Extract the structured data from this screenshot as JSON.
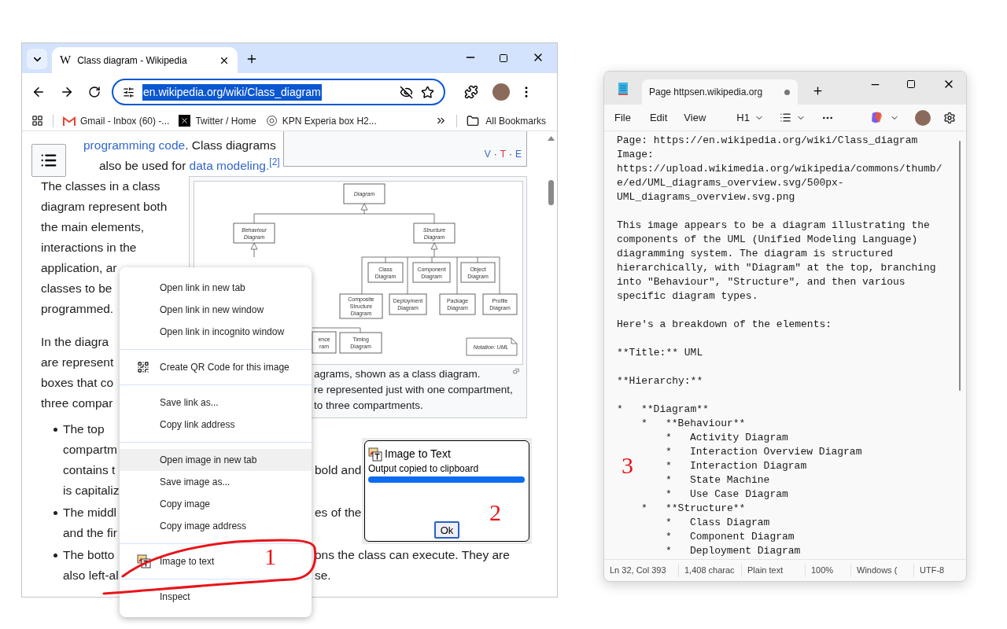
{
  "browser": {
    "tabs": [
      {
        "title": "Class diagram - Wikipedia",
        "favicon": "W",
        "selected": true
      }
    ],
    "address": {
      "url": "en.wikipedia.org/wiki/Class_diagram",
      "selected": true
    },
    "bookmarks": [
      {
        "label": "Gmail - Inbox (60) -...",
        "kind": "gmail"
      },
      {
        "label": "Twitter / Home",
        "kind": "x"
      },
      {
        "label": "KPN Experia box H2...",
        "kind": "kpn"
      }
    ],
    "all_bookmarks": "All Bookmarks",
    "navbox": {
      "links": [
        {
          "text": "V",
          "color": "#3366cc"
        },
        {
          "text": "T",
          "color": "#dd3333"
        },
        {
          "text": "E",
          "color": "#3366cc"
        }
      ],
      "separator": "·"
    },
    "intro": [
      [
        {
          "text": "programming code",
          "link": true
        },
        {
          "text": ". Class diagrams",
          "link": false
        }
      ],
      [
        {
          "text": "also be used for ",
          "link": false
        },
        {
          "text": "data modeling.",
          "link": true
        },
        {
          "text": "[2]",
          "link": true,
          "sup": true
        }
      ]
    ],
    "paragraphs": [
      [
        "The classes in a class",
        "diagram represent both",
        "the main elements,",
        "interactions in the",
        "application, ar",
        "classes to be",
        "programmed."
      ],
      [
        "In the diagra",
        "are represent",
        "boxes that co",
        "three compar"
      ]
    ],
    "figure": {
      "nodes": [
        {
          "lines": [
            "Diagram"
          ],
          "abstract": true
        },
        {
          "lines": [
            "Behaviour",
            "Diagram"
          ],
          "abstract": true
        },
        {
          "lines": [
            "Structure",
            "Diagram"
          ],
          "abstract": true
        },
        {
          "lines": [
            "Class",
            "Diagram"
          ],
          "abstract": false
        },
        {
          "lines": [
            "Component",
            "Diagram"
          ],
          "abstract": false
        },
        {
          "lines": [
            "Object",
            "Diagram"
          ],
          "abstract": false
        },
        {
          "lines": [
            "Composite",
            "Structure",
            "Diagram"
          ],
          "abstract": false
        },
        {
          "lines": [
            "Deployment",
            "Diagram"
          ],
          "abstract": false
        },
        {
          "lines": [
            "Package",
            "Diagram"
          ],
          "abstract": false
        },
        {
          "lines": [
            "Profile",
            "Diagram"
          ],
          "abstract": false
        },
        {
          "lines": [
            "ence",
            "ram"
          ],
          "abstract": false
        },
        {
          "lines": [
            "Timing",
            "Diagram"
          ],
          "abstract": false
        }
      ],
      "note": "Notation: UML",
      "caption": [
        "agrams, shown as a class diagram.",
        "re represented just with one compartment,",
        "to three compartments."
      ]
    },
    "bullets": [
      [
        {
          "left": "The top"
        },
        {
          "left": "compartm"
        },
        {
          "left": "contains t",
          "right": "bold and"
        },
        {
          "left": "is capitaliz"
        }
      ],
      [
        {
          "left": "The middl",
          "right": "es of the"
        },
        {
          "left": "and the fir"
        }
      ],
      [
        {
          "left": "The botto",
          "right": "ons the class can execute. They are"
        },
        {
          "left": "also left-al",
          "right": "se."
        }
      ]
    ]
  },
  "context_menu": {
    "groups": [
      [
        {
          "label": "Open link in new tab",
          "kind": "plain",
          "highlighted": false
        },
        {
          "label": "Open link in new window",
          "kind": "plain",
          "highlighted": false
        },
        {
          "label": "Open link in incognito window",
          "kind": "plain",
          "highlighted": false
        }
      ],
      [
        {
          "label": "Create QR Code for this image",
          "kind": "qr",
          "highlighted": false
        }
      ],
      [
        {
          "label": "Save link as...",
          "kind": "plain",
          "highlighted": false
        },
        {
          "label": "Copy link address",
          "kind": "plain",
          "highlighted": false
        }
      ],
      [
        {
          "label": "Open image in new tab",
          "kind": "plain",
          "highlighted": true
        },
        {
          "label": "Save image as...",
          "kind": "plain",
          "highlighted": false
        },
        {
          "label": "Copy image",
          "kind": "plain",
          "highlighted": false
        },
        {
          "label": "Copy image address",
          "kind": "plain",
          "highlighted": false
        }
      ],
      [
        {
          "label": "Image to text",
          "kind": "extension",
          "highlighted": false
        }
      ],
      [
        {
          "label": "Inspect",
          "kind": "plain",
          "highlighted": false
        }
      ]
    ]
  },
  "dialog": {
    "title": "Image to Text",
    "message": "Output copied to clipboard",
    "progress": {
      "level": 1
    },
    "button": "Ok"
  },
  "notepad": {
    "tab": {
      "title": "Page httpsen.wikipedia.org",
      "modified": true
    },
    "menu": [
      "File",
      "Edit",
      "View"
    ],
    "heading": "H1",
    "blocks": [
      [
        "Page: https://en.wikipedia.org/wiki/Class_diagram",
        "Image:",
        "https://upload.wikimedia.org/wikipedia/commons/thumb/",
        "e/ed/UML_diagrams_overview.svg/500px-",
        "UML_diagrams_overview.svg.png"
      ],
      [
        "This image appears to be a diagram illustrating the",
        "components of the UML (Unified Modeling Language)",
        "diagramming system. The diagram is structured",
        "hierarchically, with \"Diagram\" at the top, branching",
        "into \"Behaviour\", \"Structure\", and then various",
        "specific diagram types."
      ],
      [
        "Here's a breakdown of the elements:"
      ],
      [
        "**Title:** UML"
      ],
      [
        "**Hierarchy:**"
      ]
    ],
    "tree": [
      {
        "marker": "*",
        "text": "**Diagram**",
        "children": [
          {
            "marker": "*",
            "text": "**Behaviour**",
            "children": [
              {
                "marker": "*",
                "text": "Activity Diagram"
              },
              {
                "marker": "*",
                "text": "Interaction Overview Diagram"
              },
              {
                "marker": "*",
                "text": "Interaction Diagram"
              },
              {
                "marker": "*",
                "text": "State Machine"
              },
              {
                "marker": "*",
                "text": "Use Case Diagram"
              }
            ]
          },
          {
            "marker": "*",
            "text": "**Structure**",
            "children": [
              {
                "marker": "*",
                "text": "Class Diagram"
              },
              {
                "marker": "*",
                "text": "Component Diagram"
              },
              {
                "marker": "*",
                "text": "Deployment Diagram"
              }
            ]
          }
        ]
      }
    ],
    "status": [
      "Ln 32, Col 393",
      "1,408 charac",
      "Plain text",
      "100%",
      "Windows (",
      "UTF-8"
    ]
  },
  "annotations": [
    {
      "text": "1"
    },
    {
      "text": "2"
    },
    {
      "text": "3"
    }
  ]
}
